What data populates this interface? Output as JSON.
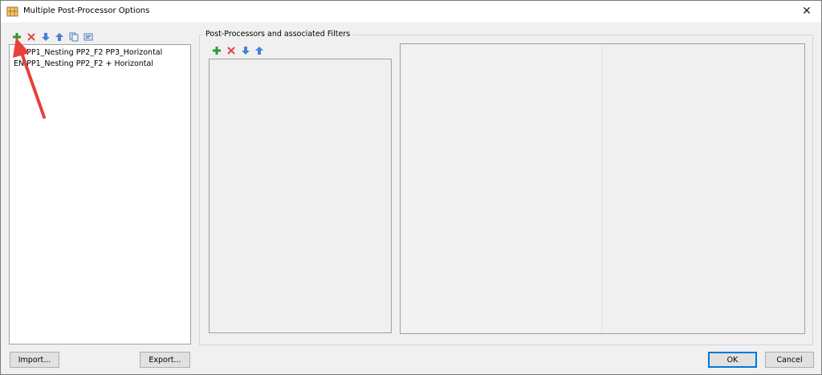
{
  "window": {
    "title": "Multiple Post-Processor Options",
    "close_glyph": "✕"
  },
  "left_toolbar": {
    "icons": [
      "add-icon",
      "delete-icon",
      "move-down-icon",
      "move-up-icon",
      "copy-icon",
      "rename-icon"
    ]
  },
  "list": {
    "items": [
      {
        "label": "EN PP1_Nesting PP2_F2 PP3_Horizontal"
      },
      {
        "label": "EN PP1_Nesting PP2_F2 + Horizontal"
      }
    ]
  },
  "group": {
    "label": "Post-Processors and associated Filters",
    "toolbar_icons": [
      "add-icon",
      "delete-icon",
      "move-down-icon",
      "move-up-icon"
    ]
  },
  "buttons": {
    "import": "Import...",
    "export": "Export...",
    "ok": "OK",
    "cancel": "Cancel"
  },
  "colors": {
    "accent": "#0078d7",
    "annotation_arrow": "#e8403a",
    "add_icon": "#2e9b2e",
    "delete_icon": "#e04848",
    "move_icon": "#4a7fd4"
  }
}
